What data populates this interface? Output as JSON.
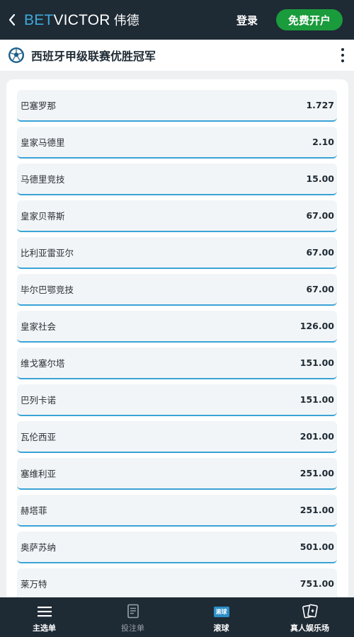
{
  "header": {
    "logo_bet": "BET",
    "logo_victor": "VICTOR",
    "logo_cn": "伟德",
    "login_label": "登录",
    "register_label": "免费开户",
    "register_color": "#1a9b3c",
    "accent_color": "#3fa9dc"
  },
  "titlebar": {
    "icon": "soccer-ball-icon",
    "title": "西班牙甲级联赛优胜冠军",
    "menu_icon": "kebab-menu-icon"
  },
  "outcomes": [
    {
      "name": "巴塞罗那",
      "odds": "1.727"
    },
    {
      "name": "皇家马德里",
      "odds": "2.10"
    },
    {
      "name": "马德里竞技",
      "odds": "15.00"
    },
    {
      "name": "皇家贝蒂斯",
      "odds": "67.00"
    },
    {
      "name": "比利亚雷亚尔",
      "odds": "67.00"
    },
    {
      "name": "毕尔巴鄂竞技",
      "odds": "67.00"
    },
    {
      "name": "皇家社会",
      "odds": "126.00"
    },
    {
      "name": "维戈塞尔塔",
      "odds": "151.00"
    },
    {
      "name": "巴列卡诺",
      "odds": "151.00"
    },
    {
      "name": "瓦伦西亚",
      "odds": "201.00"
    },
    {
      "name": "塞维利亚",
      "odds": "251.00"
    },
    {
      "name": "赫塔菲",
      "odds": "251.00"
    },
    {
      "name": "奥萨苏纳",
      "odds": "501.00"
    },
    {
      "name": "莱万特",
      "odds": "751.00"
    }
  ],
  "bottom_nav": [
    {
      "label": "主选单",
      "icon": "hamburger-menu-icon"
    },
    {
      "label": "投注单",
      "icon": "bet-slip-icon"
    },
    {
      "label": "滚球",
      "icon": "live-badge-icon",
      "badge": "滚球"
    },
    {
      "label": "真人娱乐场",
      "icon": "playing-cards-icon"
    }
  ]
}
